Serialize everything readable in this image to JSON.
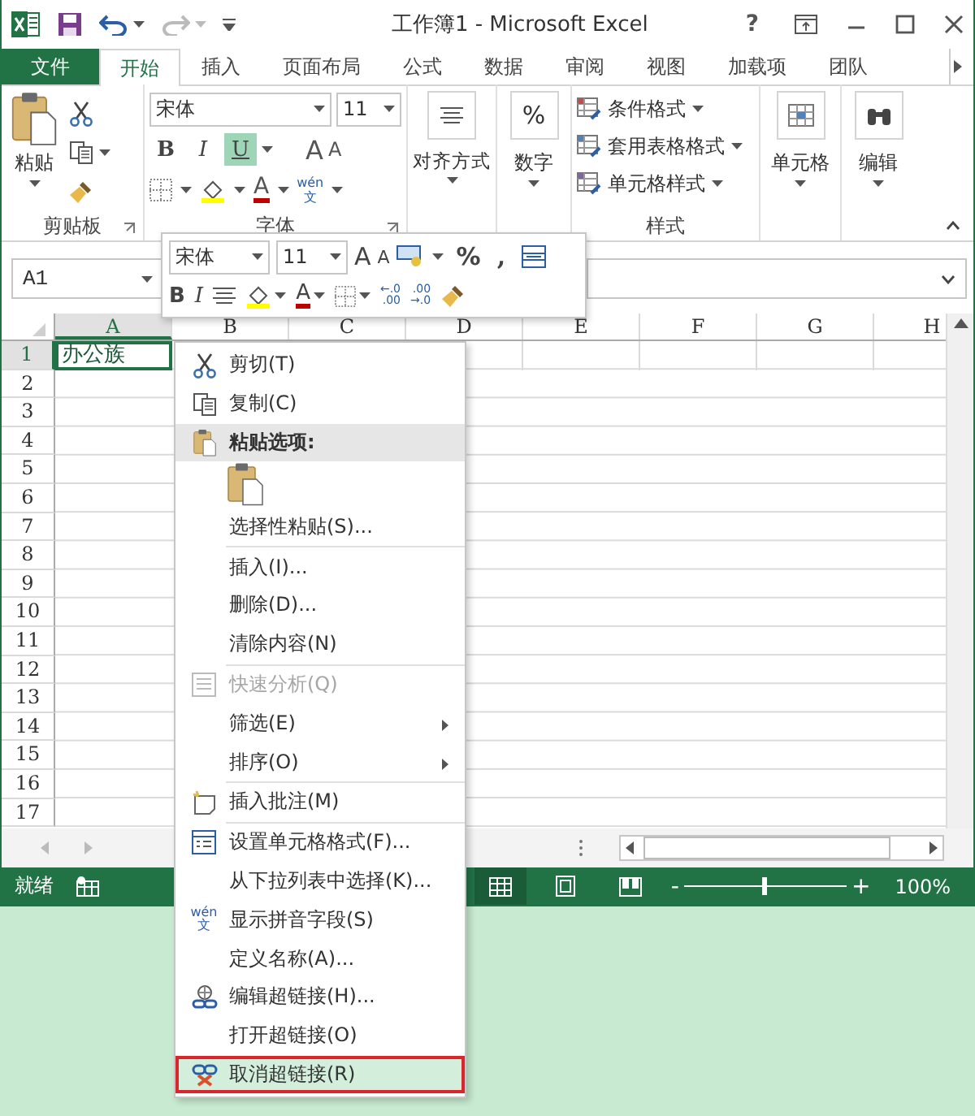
{
  "window": {
    "title": "工作簿1 - Microsoft Excel",
    "help": "?"
  },
  "tabs": [
    {
      "label": "文件",
      "kind": "file",
      "selected": false
    },
    {
      "label": "开始",
      "kind": "tab",
      "selected": true
    },
    {
      "label": "插入",
      "kind": "tab",
      "selected": false
    },
    {
      "label": "页面布局",
      "kind": "tab",
      "selected": false
    },
    {
      "label": "公式",
      "kind": "tab",
      "selected": false
    },
    {
      "label": "数据",
      "kind": "tab",
      "selected": false
    },
    {
      "label": "审阅",
      "kind": "tab",
      "selected": false
    },
    {
      "label": "视图",
      "kind": "tab",
      "selected": false
    },
    {
      "label": "加载项",
      "kind": "tab",
      "selected": false
    },
    {
      "label": "团队",
      "kind": "tab",
      "selected": false
    }
  ],
  "ribbon": {
    "clipboard": {
      "paste": "粘贴",
      "group": "剪贴板"
    },
    "font": {
      "group": "字体",
      "font_name": "宋体",
      "font_size": "11",
      "grow": "A",
      "shrink": "A",
      "font_color": "A",
      "phonetic": [
        "wén",
        "文"
      ],
      "styles": [
        {
          "label": "B",
          "selected": false
        },
        {
          "label": "I",
          "selected": false
        },
        {
          "label": "U",
          "selected": true
        }
      ]
    },
    "alignment": {
      "label": "对齐方式"
    },
    "number": {
      "symbol": "%",
      "label": "数字"
    },
    "styles": {
      "group": "样式",
      "items": [
        "条件格式",
        "套用表格格式",
        "单元格样式"
      ]
    },
    "cells": {
      "label": "单元格"
    },
    "editing": {
      "label": "编辑"
    }
  },
  "formula_bar": {
    "name_box": "A1"
  },
  "sheet": {
    "columns": [
      "A",
      "B",
      "C",
      "D",
      "E",
      "F",
      "G",
      "H"
    ],
    "rows": [
      {
        "label": "1",
        "cells": [
          {
            "text": "办公族",
            "selected": true
          }
        ]
      },
      {
        "label": "2"
      },
      {
        "label": "3"
      },
      {
        "label": "4"
      },
      {
        "label": "5"
      },
      {
        "label": "6"
      },
      {
        "label": "7"
      },
      {
        "label": "8"
      },
      {
        "label": "9"
      },
      {
        "label": "10"
      },
      {
        "label": "11"
      },
      {
        "label": "12"
      },
      {
        "label": "13"
      },
      {
        "label": "14"
      },
      {
        "label": "15"
      },
      {
        "label": "16"
      },
      {
        "label": "17"
      }
    ]
  },
  "mini_toolbar": {
    "font_name": "宋体",
    "font_size": "11",
    "grow": "A",
    "shrink": "A",
    "percent": "%",
    "comma": ",",
    "bold": "B",
    "italic": "I",
    "font_color": "A",
    "increase_decimal": [
      "←.0",
      ".00"
    ],
    "decrease_decimal": [
      ".00",
      "→.0"
    ]
  },
  "context_menu": {
    "items": [
      {
        "label": "剪切(T)",
        "kind": "item",
        "disabled": false,
        "has_submenu": false,
        "selected": false
      },
      {
        "label": "复制(C)",
        "kind": "item",
        "disabled": false,
        "has_submenu": false,
        "selected": false
      },
      {
        "label": "粘贴选项:",
        "kind": "header",
        "disabled": false,
        "has_submenu": false,
        "selected": false
      },
      {
        "kind": "paste-options",
        "selected": false
      },
      {
        "label": "选择性粘贴(S)...",
        "kind": "item",
        "disabled": false,
        "has_submenu": false,
        "selected": false
      },
      {
        "label": "插入(I)...",
        "kind": "item",
        "disabled": false,
        "has_submenu": false,
        "selected": false,
        "separator": true
      },
      {
        "label": "删除(D)...",
        "kind": "item",
        "disabled": false,
        "has_submenu": false,
        "selected": false
      },
      {
        "label": "清除内容(N)",
        "kind": "item",
        "disabled": false,
        "has_submenu": false,
        "selected": false
      },
      {
        "label": "快速分析(Q)",
        "kind": "item",
        "disabled": true,
        "has_submenu": false,
        "selected": false,
        "separator": true
      },
      {
        "label": "筛选(E)",
        "kind": "item",
        "disabled": false,
        "has_submenu": true,
        "selected": false
      },
      {
        "label": "排序(O)",
        "kind": "item",
        "disabled": false,
        "has_submenu": true,
        "selected": false
      },
      {
        "label": "插入批注(M)",
        "kind": "item",
        "disabled": false,
        "has_submenu": false,
        "selected": false,
        "separator": true
      },
      {
        "label": "设置单元格格式(F)...",
        "kind": "item",
        "disabled": false,
        "has_submenu": false,
        "selected": false,
        "separator": true
      },
      {
        "label": "从下拉列表中选择(K)...",
        "kind": "item",
        "disabled": false,
        "has_submenu": false,
        "selected": false
      },
      {
        "label": "显示拼音字段(S)",
        "kind": "item",
        "disabled": false,
        "has_submenu": false,
        "selected": false,
        "icon_text": [
          "wén",
          "文"
        ]
      },
      {
        "label": "定义名称(A)...",
        "kind": "item",
        "disabled": false,
        "has_submenu": false,
        "selected": false
      },
      {
        "label": "编辑超链接(H)...",
        "kind": "item",
        "disabled": false,
        "has_submenu": false,
        "selected": false
      },
      {
        "label": "打开超链接(O)",
        "kind": "item",
        "disabled": false,
        "has_submenu": false,
        "selected": false
      },
      {
        "label": "取消超链接(R)",
        "kind": "item",
        "disabled": false,
        "has_submenu": false,
        "selected": true
      }
    ]
  },
  "status_bar": {
    "status": "就绪",
    "views": [
      {
        "selected": true
      },
      {
        "selected": false
      },
      {
        "selected": false
      }
    ],
    "zoom": {
      "out": "-",
      "in": "+",
      "level": 0.5,
      "reading": "100%"
    }
  }
}
